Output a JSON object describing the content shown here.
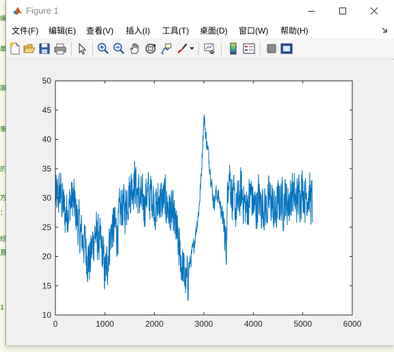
{
  "window": {
    "title": "Figure 1"
  },
  "menu": [
    "文件(F)",
    "编辑(E)",
    "查看(V)",
    "插入(I)",
    "工具(T)",
    "桌面(D)",
    "窗口(W)",
    "帮助(H)"
  ],
  "toolbar": [
    "new-figure-icon",
    "open-file-icon",
    "save-icon",
    "print-icon",
    "edit-plot-arrow-icon",
    "zoom-in-icon",
    "zoom-out-icon",
    "pan-hand-icon",
    "rotate-3d-icon",
    "data-cursor-icon",
    "brush-icon",
    "brush-dropdown-icon",
    "link-plot-icon",
    "insert-colorbar-icon",
    "insert-legend-icon",
    "hide-plot-tools-icon",
    "show-plot-tools-icon"
  ],
  "background_text": [
    "编",
    "最",
    "展",
    "象",
    "的",
    "方",
    "：",
    "经",
    "直",
    "1"
  ],
  "chart_data": {
    "type": "line",
    "xlim": [
      0,
      6000
    ],
    "ylim": [
      10,
      50
    ],
    "xticks": [
      0,
      1000,
      2000,
      3000,
      4000,
      5000,
      6000
    ],
    "yticks": [
      10,
      15,
      20,
      25,
      30,
      35,
      40,
      45,
      50
    ],
    "color": "#0072bd",
    "grid": false,
    "x_range": [
      1,
      5200
    ],
    "series": [
      {
        "x": [
          0,
          50,
          100,
          150,
          200,
          250,
          300,
          350,
          400,
          450,
          500,
          550,
          600,
          650,
          700,
          750,
          800,
          850,
          900,
          950,
          1000,
          1050,
          1100,
          1150,
          1200,
          1250,
          1300,
          1350,
          1400,
          1450,
          1500,
          1550,
          1600,
          1650,
          1700,
          1750,
          1800,
          1850,
          1900,
          1950,
          2000,
          2050,
          2100,
          2150,
          2200,
          2250,
          2300,
          2350,
          2400,
          2450,
          2500,
          2550,
          2600,
          2650,
          2700,
          2750,
          2800,
          2850,
          2900,
          2950,
          3000,
          3050,
          3100,
          3150,
          3200,
          3250,
          3300,
          3350,
          3400,
          3450,
          3500,
          3550,
          3600,
          3650,
          3700,
          3750,
          3800,
          3850,
          3900,
          3950,
          4000,
          4050,
          4100,
          4150,
          4200,
          4250,
          4300,
          4350,
          4400,
          4450,
          4500,
          4550,
          4600,
          4650,
          4700,
          4750,
          4800,
          4850,
          4900,
          4950,
          5000,
          5050,
          5100,
          5150,
          5200
        ],
        "y": [
          30,
          30,
          31,
          29,
          27,
          28,
          29,
          30,
          28,
          26,
          24,
          23,
          22,
          20,
          19,
          22,
          24,
          23,
          22,
          21,
          17,
          19,
          23,
          25,
          25,
          24,
          27,
          29,
          28,
          30,
          31,
          32,
          33,
          31,
          30,
          29,
          29,
          31,
          30,
          31,
          29,
          28,
          30,
          29,
          30,
          29,
          28,
          27,
          26,
          24,
          21,
          19,
          17,
          15,
          18,
          20,
          22,
          25,
          28,
          34,
          44,
          40,
          37,
          33,
          29,
          31,
          30,
          28,
          26,
          21,
          36,
          32,
          29,
          28,
          29,
          31,
          30,
          28,
          29,
          31,
          29,
          28,
          30,
          29,
          29,
          28,
          29,
          30,
          28,
          27,
          29,
          30,
          29,
          30,
          29,
          30,
          31,
          29,
          30,
          31,
          32,
          30,
          31,
          30,
          29
        ]
      }
    ]
  }
}
